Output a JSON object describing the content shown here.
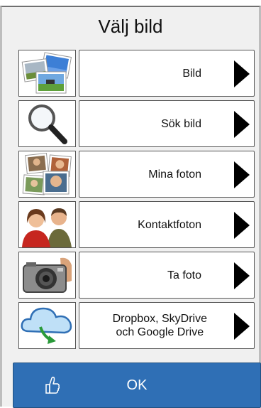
{
  "dialog": {
    "title": "Välj bild"
  },
  "options": [
    {
      "label": "Bild",
      "icon": "photos-icon"
    },
    {
      "label": "Sök bild",
      "icon": "magnifier-icon"
    },
    {
      "label": "Mina foton",
      "icon": "my-photos-icon"
    },
    {
      "label": "Kontaktfoton",
      "icon": "contacts-icon"
    },
    {
      "label": "Ta foto",
      "icon": "camera-icon"
    },
    {
      "label": "Dropbox, SkyDrive\noch Google Drive",
      "icon": "cloud-download-icon"
    }
  ],
  "ok_button": {
    "label": "OK",
    "icon": "thumbs-up-icon",
    "color": "#2f6fb5"
  }
}
